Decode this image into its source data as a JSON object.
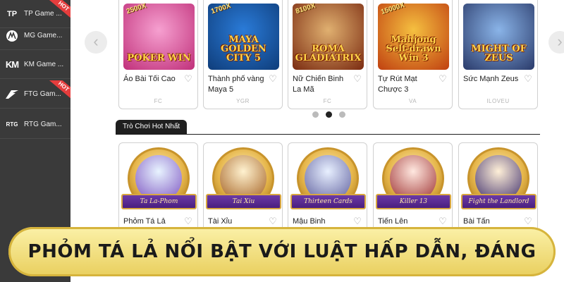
{
  "sidebar": {
    "items": [
      {
        "label": "TP Game ...",
        "icon": "tp-logo-icon",
        "glyph": "TP",
        "hot": true
      },
      {
        "label": "MG Game...",
        "icon": "mg-logo-icon",
        "glyph": "M",
        "hot": false
      },
      {
        "label": "KM Game ...",
        "icon": "km-logo-icon",
        "glyph": "KM",
        "hot": false
      },
      {
        "label": "FTG Gam...",
        "icon": "ftg-logo-icon",
        "glyph": "F",
        "hot": true
      },
      {
        "label": "RTG Gam...",
        "icon": "rtg-logo-icon",
        "glyph": "RTG",
        "hot": false
      }
    ],
    "hot_label": "HOT"
  },
  "carousel": {
    "prev_glyph": "‹",
    "next_glyph": "›",
    "cards": [
      {
        "name": "Áo Bài Tối Cao",
        "provider": "FC",
        "logo": "POKER WIN",
        "multiplier": "2500X",
        "bg1": "#f6a0d0",
        "bg2": "#c0307a"
      },
      {
        "name": "Thành phố vàng Maya 5",
        "provider": "YGR",
        "logo": "MAYA GOLDEN CITY 5",
        "multiplier": "1700X",
        "bg1": "#2a7bd8",
        "bg2": "#0f3d7a"
      },
      {
        "name": "Nữ Chiến Binh La Mã",
        "provider": "FC",
        "logo": "ROMA GLADIATRIX",
        "multiplier": "8100X",
        "bg1": "#e0b070",
        "bg2": "#7a2a10"
      },
      {
        "name": "Tự Rút Mạt Chược 3",
        "provider": "VA",
        "logo": "Mahjong Self-drawn Win 3",
        "multiplier": "15000X",
        "bg1": "#f5c040",
        "bg2": "#c04010"
      },
      {
        "name": "Sức Mạnh Zeus",
        "provider": "ILOVEU",
        "logo": "MIGHT OF ZEUS",
        "multiplier": "",
        "bg1": "#8ab4e8",
        "bg2": "#2a3a6a"
      }
    ],
    "dots": [
      false,
      true,
      false
    ]
  },
  "hot_section": {
    "title": "Trò Chơi Hot Nhất",
    "cards": [
      {
        "name": "Phỏm Tá Lả",
        "ribbon": "Ta La-Phom",
        "c1": "#e8f4ff",
        "c2": "#7a4fbf"
      },
      {
        "name": "Tài Xỉu",
        "ribbon": "Tai Xiu",
        "c1": "#fff2d0",
        "c2": "#a05a1a"
      },
      {
        "name": "Mậu Binh",
        "ribbon": "Thirteen Cards",
        "c1": "#e8f0ff",
        "c2": "#5a5a9a"
      },
      {
        "name": "Tiến Lên",
        "ribbon": "Killer 13",
        "c1": "#ffe8e0",
        "c2": "#9a2a2a"
      },
      {
        "name": "Bài Tấn",
        "ribbon": "Fight the Landlord",
        "c1": "#fff0d8",
        "c2": "#3a2a6a"
      }
    ]
  },
  "banner": {
    "text": "PHỎM TÁ LẢ NỔI BẬT VỚI LUẬT HẤP DẪN, ĐÁNG THỬ"
  },
  "colors": {
    "sidebar_bg": "#3a3a3a",
    "hot_red": "#e53d3d",
    "banner_gold": "#e9cf5e",
    "ribbon_purple": "#5a2a90"
  },
  "icons": {
    "heart": "heart-outline-icon",
    "heart_glyph": "♡"
  }
}
